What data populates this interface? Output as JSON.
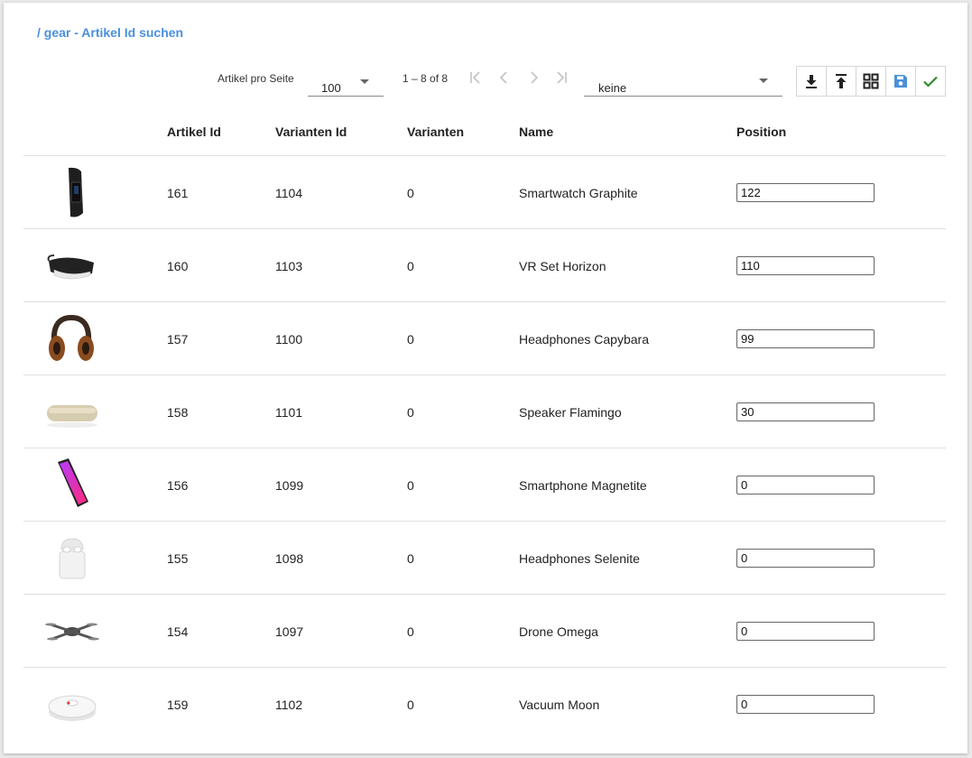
{
  "breadcrumb": "/ gear - Artikel Id suchen",
  "paginator": {
    "per_page_label": "Artikel pro Seite",
    "per_page_value": "100",
    "range_label": "1 – 8 of 8"
  },
  "sort": {
    "value": "keine"
  },
  "colors": {
    "accent": "#4a8fdb",
    "check": "#2e8b2e",
    "disabled": "#c2c2c2"
  },
  "table": {
    "columns": [
      "Artikel Id",
      "Varianten Id",
      "Varianten",
      "Name",
      "Position"
    ],
    "rows": [
      {
        "image": "smartwatch-icon",
        "artikel_id": "161",
        "varianten_id": "1104",
        "varianten": "0",
        "name": "Smartwatch Graphite",
        "position": "122"
      },
      {
        "image": "vr-headset-icon",
        "artikel_id": "160",
        "varianten_id": "1103",
        "varianten": "0",
        "name": "VR Set Horizon",
        "position": "110"
      },
      {
        "image": "headphones-icon",
        "artikel_id": "157",
        "varianten_id": "1100",
        "varianten": "0",
        "name": "Headphones Capybara",
        "position": "99"
      },
      {
        "image": "speaker-icon",
        "artikel_id": "158",
        "varianten_id": "1101",
        "varianten": "0",
        "name": "Speaker Flamingo",
        "position": "30"
      },
      {
        "image": "smartphone-icon",
        "artikel_id": "156",
        "varianten_id": "1099",
        "varianten": "0",
        "name": "Smartphone Magnetite",
        "position": "0"
      },
      {
        "image": "earbuds-icon",
        "artikel_id": "155",
        "varianten_id": "1098",
        "varianten": "0",
        "name": "Headphones Selenite",
        "position": "0"
      },
      {
        "image": "drone-icon",
        "artikel_id": "154",
        "varianten_id": "1097",
        "varianten": "0",
        "name": "Drone Omega",
        "position": "0"
      },
      {
        "image": "robot-vacuum-icon",
        "artikel_id": "159",
        "varianten_id": "1102",
        "varianten": "0",
        "name": "Vacuum Moon",
        "position": "0"
      }
    ]
  }
}
